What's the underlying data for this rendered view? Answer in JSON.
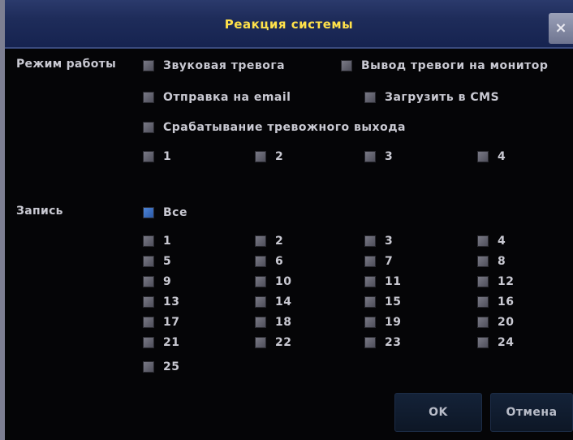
{
  "dialog": {
    "title": "Реакция системы",
    "close_label": "×"
  },
  "mode": {
    "label": "Режим работы",
    "options": [
      {
        "label": "Звуковая тревога",
        "checked": true
      },
      {
        "label": "Вывод тревоги на монитор",
        "checked": true
      },
      {
        "label": "Отправка на email",
        "checked": true
      },
      {
        "label": "Загрузить в CMS",
        "checked": true
      },
      {
        "label": "Срабатывание тревожного выхода",
        "checked": true
      }
    ],
    "outputs": [
      "1",
      "2",
      "3",
      "4"
    ]
  },
  "record": {
    "label": "Запись",
    "all_label": "Все",
    "channels": [
      "1",
      "2",
      "3",
      "4",
      "5",
      "6",
      "7",
      "8",
      "9",
      "10",
      "11",
      "12",
      "13",
      "14",
      "15",
      "16",
      "17",
      "18",
      "19",
      "20",
      "21",
      "22",
      "23",
      "24",
      "25"
    ]
  },
  "buttons": {
    "ok": "OK",
    "cancel": "Отмена"
  },
  "colors": {
    "title_text": "#ffe14a",
    "checkbox": "#6a6a76",
    "checkbox_all": "#3f74c4",
    "background": "#050507"
  }
}
